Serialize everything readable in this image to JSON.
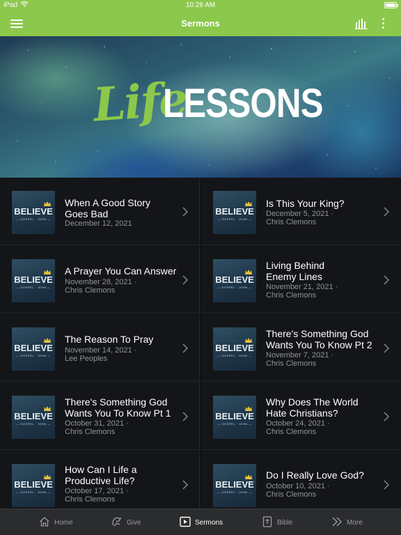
{
  "status": {
    "carrier": "iPad",
    "time": "10:26 AM"
  },
  "header": {
    "title": "Sermons"
  },
  "banner": {
    "word1": "Life",
    "word2": "LESSONS"
  },
  "thumb": {
    "brand": "BELIEVE",
    "subtitle": "— GOSPEL · JOHN —"
  },
  "sermons": [
    {
      "title_lines": [
        "When A Good Story",
        "Goes Bad"
      ],
      "date": "December 12, 2021",
      "speaker": ""
    },
    {
      "title_lines": [
        "Is This Your King?"
      ],
      "date": "December 5, 2021 ·",
      "speaker": "Chris Clemons"
    },
    {
      "title_lines": [
        "A Prayer You Can Answer"
      ],
      "date": "November 28, 2021 ·",
      "speaker": "Chris Clemons"
    },
    {
      "title_lines": [
        "Living Behind",
        "Enemy Lines"
      ],
      "date": "November 21, 2021 ·",
      "speaker": "Chris Clemons"
    },
    {
      "title_lines": [
        "The Reason To Pray"
      ],
      "date": "November 14, 2021 ·",
      "speaker": "Lee Peoples"
    },
    {
      "title_lines": [
        "There's Something God",
        "Wants You To Know Pt 2"
      ],
      "date": "November 7, 2021 ·",
      "speaker": "Chris Clemons"
    },
    {
      "title_lines": [
        "There's Something God",
        "Wants You To Know Pt 1"
      ],
      "date": "October 31, 2021 ·",
      "speaker": "Chris Clemons"
    },
    {
      "title_lines": [
        "Why Does The World",
        "Hate Christians?"
      ],
      "date": "October 24, 2021 ·",
      "speaker": "Chris Clemons"
    },
    {
      "title_lines": [
        "How Can I Life a",
        "Productive Life?"
      ],
      "date": "October 17, 2021 ·",
      "speaker": "Chris Clemons"
    },
    {
      "title_lines": [
        "Do I Really Love God?"
      ],
      "date": "October 10, 2021 ·",
      "speaker": "Chris Clemons"
    }
  ],
  "tabs": [
    {
      "label": "Home",
      "icon": "home-icon"
    },
    {
      "label": "Give",
      "icon": "give-icon"
    },
    {
      "label": "Sermons",
      "icon": "play-icon",
      "active": true
    },
    {
      "label": "Bible",
      "icon": "bible-icon"
    },
    {
      "label": "More",
      "icon": "more-chevrons-icon"
    }
  ],
  "colors": {
    "accent": "#8cc84b",
    "background": "#111214",
    "tabbar": "#2b2c2e"
  }
}
